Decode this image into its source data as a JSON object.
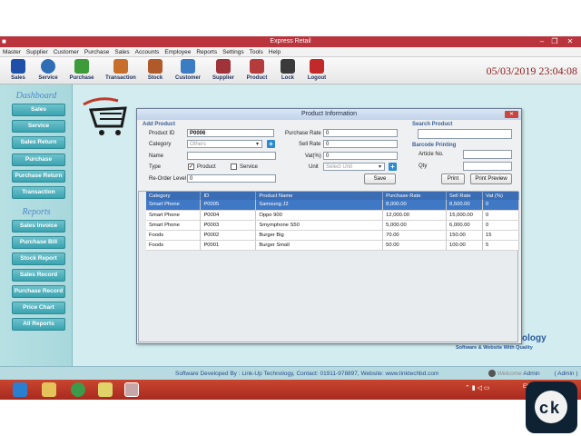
{
  "window": {
    "title": "Express Retail"
  },
  "menu": [
    "Master",
    "Supplier",
    "Customer",
    "Purchase",
    "Sales",
    "Accounts",
    "Employee",
    "Reports",
    "Settings",
    "Tools",
    "Help"
  ],
  "toolbar": {
    "items": [
      {
        "label": "Sales",
        "icon": "cart-icon",
        "color": "#1f4fa8"
      },
      {
        "label": "Service",
        "icon": "gear-icon",
        "color": "#2f6db5"
      },
      {
        "label": "Purchase",
        "icon": "purchase-icon",
        "color": "#3d9b3a"
      },
      {
        "label": "Transaction",
        "icon": "transaction-icon",
        "color": "#c76f2a"
      },
      {
        "label": "Stock",
        "icon": "home-icon",
        "color": "#b05a2a"
      },
      {
        "label": "Customer",
        "icon": "customer-icon",
        "color": "#3b7cc2"
      },
      {
        "label": "Supplier",
        "icon": "supplier-icon",
        "color": "#a0323a"
      },
      {
        "label": "Product",
        "icon": "product-icon",
        "color": "#b53c3c"
      },
      {
        "label": "Lock",
        "icon": "lock-icon",
        "color": "#3a3a3a"
      },
      {
        "label": "Logout",
        "icon": "logout-icon",
        "color": "#c22a2a"
      }
    ],
    "datetime": "05/03/2019 23:04:08"
  },
  "sidebar": {
    "dashboard_heading": "Dashboard",
    "dashboard_items": [
      "Sales",
      "Service",
      "Sales Return",
      "Purchase",
      "Purchase Return",
      "Transaction"
    ],
    "reports_heading": "Reports",
    "reports_items": [
      "Sales Invoice",
      "Purchase Bill",
      "Stock Report",
      "Sales Record",
      "Purchase Record",
      "Price Chart",
      "All Reports"
    ]
  },
  "dialog": {
    "title": "Product Information",
    "add_product": {
      "heading": "Add Product",
      "product_id_label": "Product ID",
      "product_id_value": "P0006",
      "category_label": "Category",
      "category_placeholder": "Others",
      "name_label": "Name",
      "name_value": "",
      "type_label": "Type",
      "type_product_label": "Product",
      "type_service_label": "Service",
      "type_product_checked": true,
      "type_service_checked": false,
      "reorder_label": "Re-Order Level",
      "reorder_value": "0",
      "purchase_rate_label": "Purchase Rate",
      "purchase_rate_value": "0",
      "sell_rate_label": "Sell Rate",
      "sell_rate_value": "0",
      "vat_label": "Vat(%)",
      "vat_value": "0",
      "unit_label": "Unit",
      "unit_placeholder": "Select Unit",
      "save_label": "Save"
    },
    "search": {
      "heading": "Search Product",
      "value": ""
    },
    "barcode": {
      "heading": "Barcode Printing",
      "article_label": "Article No.",
      "qty_label": "Qty",
      "print_label": "Print",
      "preview_label": "Print Preview"
    },
    "table": {
      "columns": [
        "Category",
        "ID",
        "Product Name",
        "Purchase Rate",
        "Sell Rate",
        "Vat (%)"
      ],
      "rows": [
        [
          "Smart Phone",
          "P0005",
          "Samsung J2",
          "8,000.00",
          "8,500.00",
          "0"
        ],
        [
          "Smart Phone",
          "P0004",
          "Oppo 900",
          "12,000.00",
          "15,000.00",
          "0"
        ],
        [
          "Smart Phone",
          "P0003",
          "Smymphone S50",
          "5,000.00",
          "6,000.00",
          "0"
        ],
        [
          "Foods",
          "P0002",
          "Burger Big",
          "70.00",
          "150.00",
          "15"
        ],
        [
          "Foods",
          "P0001",
          "Burger Small",
          "50.00",
          "100.00",
          "5"
        ]
      ],
      "selected_row": 0
    }
  },
  "brand_tail": {
    "line1": "ology",
    "line2": "Software & Website With Quality"
  },
  "status": {
    "developer_text": "Software Developed By : Link-Up Technology, Contact: 01911-978897, Website:  www.linktechbd.com",
    "welcome_text": "Welcome",
    "user": "Admin",
    "role": "( Admin )"
  },
  "taskbar": {
    "lang": "ENG"
  },
  "colors": {
    "titlebar": "#b9343c",
    "taskbar": "#a82a1f",
    "sidebar_btn": "#3aa3b0",
    "grid_header": "#3a6db3"
  }
}
